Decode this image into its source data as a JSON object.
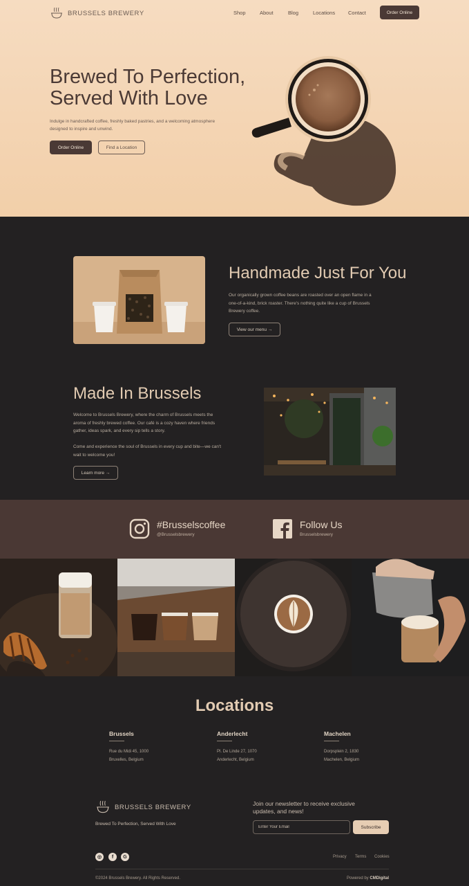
{
  "brand": {
    "name": "BRUSSELS BREWERY"
  },
  "nav": {
    "items": [
      "Shop",
      "About",
      "Blog",
      "Locations",
      "Contact"
    ],
    "cta": "Order Online"
  },
  "hero": {
    "title_line1": "Brewed To Perfection,",
    "title_line2": "Served With Love",
    "subtitle_line1": "Indulge in handcrafted coffee, freshly baked pastries, and a welcoming atmosphere",
    "subtitle_line2": "designed to inspire and unwind.",
    "primary_btn": "Order Online",
    "secondary_btn": "Find a Location"
  },
  "handmade": {
    "title": "Handmade Just For You",
    "body": "Our organically grown coffee beans are roasted over an open flame in a one-of-a-kind, brick roaster. There's nothing quite like a cup of Brussels Brewery coffee.",
    "btn": "View our menu →"
  },
  "made_in": {
    "title": "Made In Brussels",
    "p1": "Welcome to Brussels Brewery, where the charm of Brussels meets the aroma of freshly brewed coffee. Our café is a cozy haven where friends gather, ideas spark, and every sip tells a story.",
    "p2": "Come and experience the soul of Brussels in every cup and bite—we can't wait to welcome you!",
    "btn": "Learn more →"
  },
  "social": {
    "instagram": {
      "title": "#Brusselscoffee",
      "handle": "@Brusselsbrewery"
    },
    "facebook": {
      "title": "Follow Us",
      "handle": "Brusselsbrewery"
    }
  },
  "locations": {
    "title": "Locations",
    "items": [
      {
        "name": "Brussels",
        "line1": "Rue du Midi 45, 1000",
        "line2": "Bruxelles, Belgium"
      },
      {
        "name": "Anderlecht",
        "line1": "Pl. De Linde 27, 1070",
        "line2": "Anderlecht, Belgium"
      },
      {
        "name": "Machelen",
        "line1": "Dorpsplein 2, 1830",
        "line2": "Machelen, Belgium"
      }
    ]
  },
  "footer": {
    "tagline": "Brewed To Perfection, Served With Love",
    "newsletter": "Join our newsletter to receive exclusive updates, and news!",
    "email_placeholder": "Enter Your Email",
    "subscribe": "Subscribe",
    "links": [
      "Privacy",
      "Terms",
      "Cookies"
    ],
    "social_glyphs": [
      "◎",
      "f",
      "G"
    ],
    "copyright": "©2024 Brussels Brewery. All Rights Reserved.",
    "powered_prefix": "Powered by ",
    "powered_by": "CMDigital"
  },
  "colors": {
    "hero_bg": "#f4d6b6",
    "dark_bg": "#232122",
    "social_bar": "#4a3834",
    "accent": "#e6cdb3",
    "button_dark": "#4a3935"
  },
  "icons": [
    "cup-logo-icon",
    "instagram-icon",
    "facebook-icon",
    "google-icon"
  ]
}
